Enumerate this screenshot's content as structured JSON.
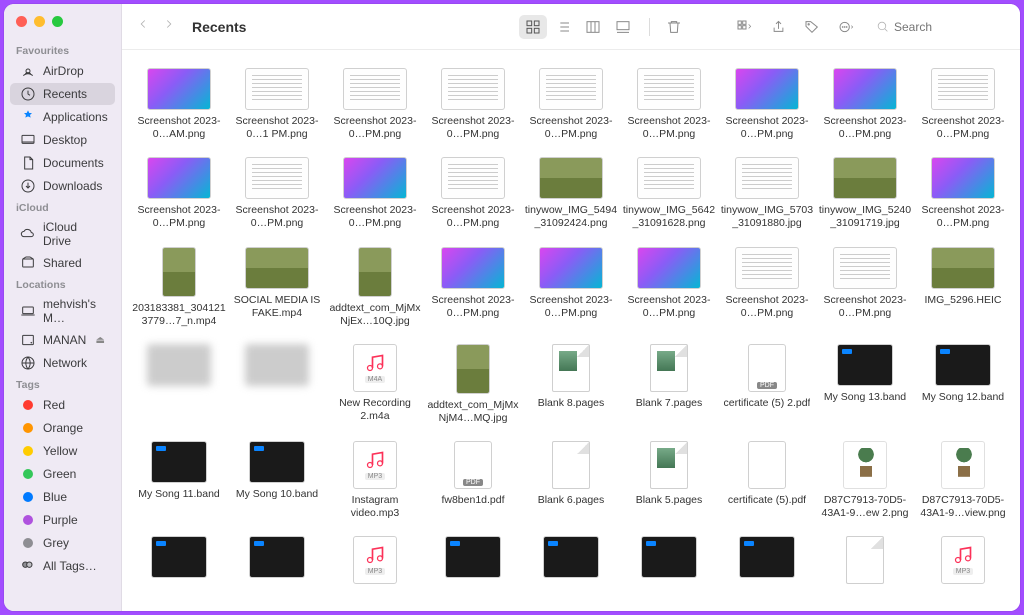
{
  "window": {
    "title": "Recents"
  },
  "search": {
    "placeholder": "Search"
  },
  "sidebar": {
    "sections": [
      {
        "title": "Favourites",
        "items": [
          {
            "label": "AirDrop",
            "icon": "airdrop"
          },
          {
            "label": "Recents",
            "icon": "clock",
            "selected": true
          },
          {
            "label": "Applications",
            "icon": "apps"
          },
          {
            "label": "Desktop",
            "icon": "desktop"
          },
          {
            "label": "Documents",
            "icon": "document"
          },
          {
            "label": "Downloads",
            "icon": "downloads"
          }
        ]
      },
      {
        "title": "iCloud",
        "items": [
          {
            "label": "iCloud Drive",
            "icon": "cloud"
          },
          {
            "label": "Shared",
            "icon": "shared"
          }
        ]
      },
      {
        "title": "Locations",
        "items": [
          {
            "label": "mehvish's M…",
            "icon": "laptop"
          },
          {
            "label": "MANAN",
            "icon": "disk",
            "eject": true
          },
          {
            "label": "Network",
            "icon": "network"
          }
        ]
      },
      {
        "title": "Tags",
        "items": [
          {
            "label": "Red",
            "tag": "#ff3b30"
          },
          {
            "label": "Orange",
            "tag": "#ff9500"
          },
          {
            "label": "Yellow",
            "tag": "#ffcc00"
          },
          {
            "label": "Green",
            "tag": "#34c759"
          },
          {
            "label": "Blue",
            "tag": "#007aff"
          },
          {
            "label": "Purple",
            "tag": "#af52de"
          },
          {
            "label": "Grey",
            "tag": "#8e8e93"
          },
          {
            "label": "All Tags…",
            "icon": "alltags"
          }
        ]
      }
    ]
  },
  "files": [
    [
      {
        "name": "Screenshot 2023-0…AM.png",
        "thumb": "grad"
      },
      {
        "name": "Screenshot 2023-0…1 PM.png",
        "thumb": "doc"
      },
      {
        "name": "Screenshot 2023-0…PM.png",
        "thumb": "doc"
      },
      {
        "name": "Screenshot 2023-0…PM.png",
        "thumb": "doc"
      },
      {
        "name": "Screenshot 2023-0…PM.png",
        "thumb": "doc"
      },
      {
        "name": "Screenshot 2023-0…PM.png",
        "thumb": "doc"
      },
      {
        "name": "Screenshot 2023-0…PM.png",
        "thumb": "grad"
      },
      {
        "name": "Screenshot 2023-0…PM.png",
        "thumb": "grad"
      },
      {
        "name": "Screenshot 2023-0…PM.png",
        "thumb": "doc"
      }
    ],
    [
      {
        "name": "Screenshot 2023-0…PM.png",
        "thumb": "grad"
      },
      {
        "name": "Screenshot 2023-0…PM.png",
        "thumb": "doc"
      },
      {
        "name": "Screenshot 2023-0…PM.png",
        "thumb": "grad"
      },
      {
        "name": "Screenshot 2023-0…PM.png",
        "thumb": "doc"
      },
      {
        "name": "tinywow_IMG_5494_31092424.png",
        "thumb": "photo"
      },
      {
        "name": "tinywow_IMG_5642_31091628.png",
        "thumb": "doc"
      },
      {
        "name": "tinywow_IMG_5703_31091880.jpg",
        "thumb": "doc"
      },
      {
        "name": "tinywow_IMG_5240_31091719.jpg",
        "thumb": "photo"
      },
      {
        "name": "Screenshot 2023-0…PM.png",
        "thumb": "grad"
      }
    ],
    [
      {
        "name": "203183381_3041213779…7_n.mp4",
        "thumb": "tall photo"
      },
      {
        "name": "SOCIAL MEDIA IS FAKE.mp4",
        "thumb": "photo"
      },
      {
        "name": "addtext_com_MjMxNjEx…10Q.jpg",
        "thumb": "tall photo"
      },
      {
        "name": "Screenshot 2023-0…PM.png",
        "thumb": "grad"
      },
      {
        "name": "Screenshot 2023-0…PM.png",
        "thumb": "grad"
      },
      {
        "name": "Screenshot 2023-0…PM.png",
        "thumb": "grad"
      },
      {
        "name": "Screenshot 2023-0…PM.png",
        "thumb": "doc"
      },
      {
        "name": "Screenshot 2023-0…PM.png",
        "thumb": "doc"
      },
      {
        "name": "IMG_5296.HEIC",
        "thumb": "photo"
      }
    ],
    [
      {
        "name": "",
        "thumb": "blur"
      },
      {
        "name": "",
        "thumb": "blur"
      },
      {
        "name": "New Recording 2.m4a",
        "thumb": "audio",
        "ext": "M4A"
      },
      {
        "name": "addtext_com_MjMxNjM4…MQ.jpg",
        "thumb": "tall photo"
      },
      {
        "name": "Blank 8.pages",
        "thumb": "page withimg"
      },
      {
        "name": "Blank 7.pages",
        "thumb": "page withimg"
      },
      {
        "name": "certificate (5) 2.pdf",
        "thumb": "pdf pdf-badge"
      },
      {
        "name": "My Song 13.band",
        "thumb": "dark"
      },
      {
        "name": "My Song 12.band",
        "thumb": "dark"
      }
    ],
    [
      {
        "name": "My Song 11.band",
        "thumb": "dark"
      },
      {
        "name": "My Song 10.band",
        "thumb": "dark"
      },
      {
        "name": "Instagram video.mp3",
        "thumb": "audio",
        "ext": "MP3"
      },
      {
        "name": "fw8ben1d.pdf",
        "thumb": "pdf pdf-badge"
      },
      {
        "name": "Blank 6.pages",
        "thumb": "page"
      },
      {
        "name": "Blank 5.pages",
        "thumb": "page withimg"
      },
      {
        "name": "certificate (5).pdf",
        "thumb": "pdf"
      },
      {
        "name": "D87C7913-70D5-43A1-9…ew 2.png",
        "thumb": "plant"
      },
      {
        "name": "D87C7913-70D5-43A1-9…view.png",
        "thumb": "plant"
      }
    ],
    [
      {
        "name": "",
        "thumb": "dark"
      },
      {
        "name": "",
        "thumb": "dark"
      },
      {
        "name": "",
        "thumb": "audio",
        "ext": "MP3"
      },
      {
        "name": "",
        "thumb": "dark"
      },
      {
        "name": "",
        "thumb": "dark"
      },
      {
        "name": "",
        "thumb": "dark"
      },
      {
        "name": "",
        "thumb": "dark"
      },
      {
        "name": "",
        "thumb": "page"
      },
      {
        "name": "",
        "thumb": "audio",
        "ext": "MP3"
      }
    ]
  ]
}
